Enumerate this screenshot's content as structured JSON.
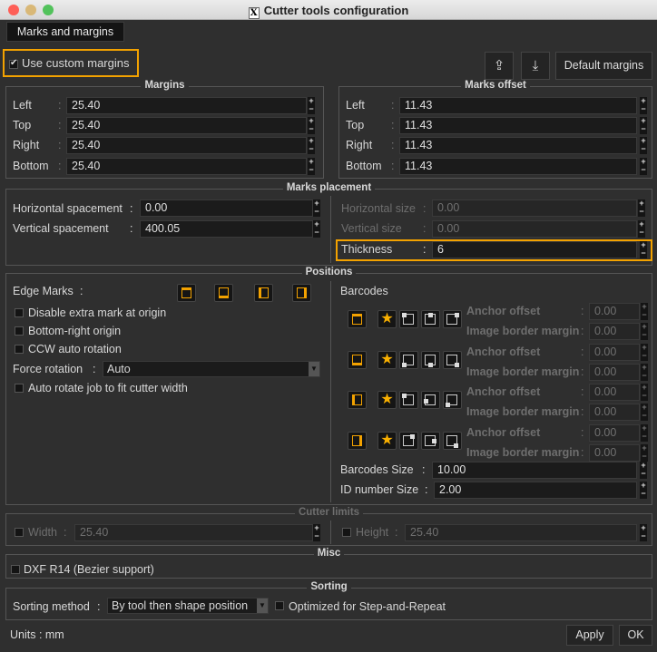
{
  "window": {
    "title": "Cutter tools configuration"
  },
  "tab": "Marks and margins",
  "use_custom_margins": {
    "label": "Use custom margins",
    "checked": true
  },
  "toolbar": {
    "export_icon": "export-icon",
    "import_icon": "import-icon",
    "default_margins": "Default margins"
  },
  "margins": {
    "title": "Margins",
    "rows": [
      {
        "label": "Left",
        "value": "25.40"
      },
      {
        "label": "Top",
        "value": "25.40"
      },
      {
        "label": "Right",
        "value": "25.40"
      },
      {
        "label": "Bottom",
        "value": "25.40"
      }
    ]
  },
  "marks_offset": {
    "title": "Marks offset",
    "rows": [
      {
        "label": "Left",
        "value": "11.43"
      },
      {
        "label": "Top",
        "value": "11.43"
      },
      {
        "label": "Right",
        "value": "11.43"
      },
      {
        "label": "Bottom",
        "value": "11.43"
      }
    ]
  },
  "marks_placement": {
    "title": "Marks placement",
    "horizontal_spacement": {
      "label": "Horizontal spacement",
      "value": "0.00"
    },
    "vertical_spacement": {
      "label": "Vertical spacement",
      "value": "400.05"
    },
    "horizontal_size": {
      "label": "Horizontal size",
      "value": "0.00"
    },
    "vertical_size": {
      "label": "Vertical size",
      "value": "0.00"
    },
    "thickness": {
      "label": "Thickness",
      "value": "6"
    }
  },
  "positions": {
    "title": "Positions",
    "edge_marks": "Edge Marks",
    "disable_extra": "Disable extra mark at origin",
    "bottom_right": "Bottom-right origin",
    "ccw": "CCW auto rotation",
    "force_rotation": {
      "label": "Force rotation",
      "value": "Auto"
    },
    "auto_rotate": "Auto rotate job to fit cutter width",
    "barcodes": {
      "label": "Barcodes",
      "rows": [
        {
          "anchor_label": "Anchor offset",
          "anchor": "0.00",
          "border_label": "Image border margin",
          "border": "0.00"
        },
        {
          "anchor_label": "Anchor offset",
          "anchor": "0.00",
          "border_label": "Image border margin",
          "border": "0.00"
        },
        {
          "anchor_label": "Anchor offset",
          "anchor": "0.00",
          "border_label": "Image border margin",
          "border": "0.00"
        },
        {
          "anchor_label": "Anchor offset",
          "anchor": "0.00",
          "border_label": "Image border margin",
          "border": "0.00"
        }
      ],
      "size": {
        "label": "Barcodes Size",
        "value": "10.00"
      },
      "id_size": {
        "label": "ID number Size",
        "value": "2.00"
      }
    }
  },
  "cutter_limits": {
    "title": "Cutter limits",
    "width": {
      "label": "Width",
      "value": "25.40"
    },
    "height": {
      "label": "Height",
      "value": "25.40"
    }
  },
  "misc": {
    "title": "Misc",
    "dxf": "DXF R14 (Bezier support)"
  },
  "sorting": {
    "title": "Sorting",
    "method_label": "Sorting method",
    "method": "By tool then shape position",
    "optimized": "Optimized for Step-and-Repeat"
  },
  "footer": {
    "units": "Units : mm",
    "apply": "Apply",
    "ok": "OK"
  },
  "colors": {
    "accent": "#f3a200",
    "background": "#2f2f2f"
  }
}
